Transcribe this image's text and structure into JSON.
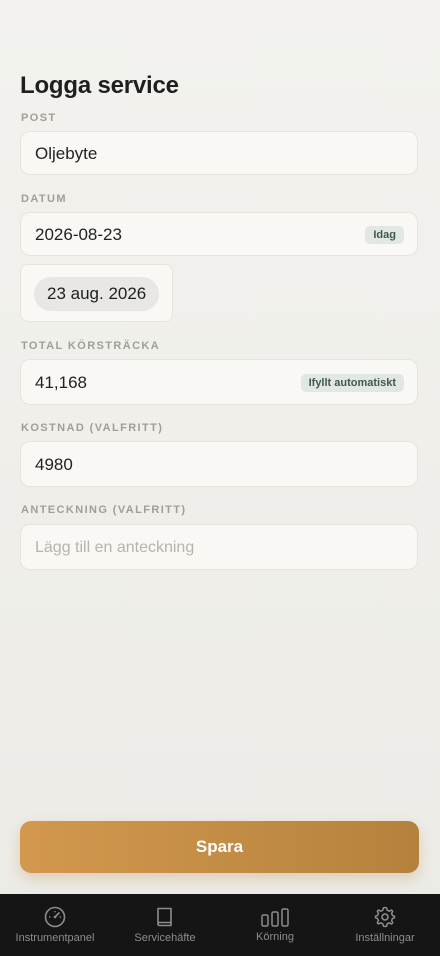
{
  "page": {
    "title": "Logga service"
  },
  "post": {
    "label": "POST",
    "value": "Oljebyte"
  },
  "datum": {
    "label": "DATUM",
    "value": "2026-08-23",
    "today_badge": "Idag",
    "picker_value": "23 aug. 2026"
  },
  "mileage": {
    "label": "TOTAL KÖRSTRÄCKA",
    "value": "41,168",
    "auto_badge": "Ifyllt automatiskt"
  },
  "cost": {
    "label": "KOSTNAD (VALFRITT)",
    "value": "4980"
  },
  "note": {
    "label": "ANTECKNING (VALFRITT)",
    "placeholder": "Lägg till en anteckning"
  },
  "save": {
    "label": "Spara"
  },
  "tabs": [
    {
      "label": "Instrumentpanel",
      "icon": "speedometer-icon"
    },
    {
      "label": "Servicehäfte",
      "icon": "book-icon"
    },
    {
      "label": "Körning",
      "icon": "bar-chart-icon"
    },
    {
      "label": "Inställningar",
      "icon": "gear-icon"
    }
  ],
  "colors": {
    "accent_start": "#d3984e",
    "accent_end": "#b4823d",
    "badge_bg": "#e3e7e2",
    "badge_text": "#3f5a4d",
    "tabbar_bg": "#151515"
  }
}
